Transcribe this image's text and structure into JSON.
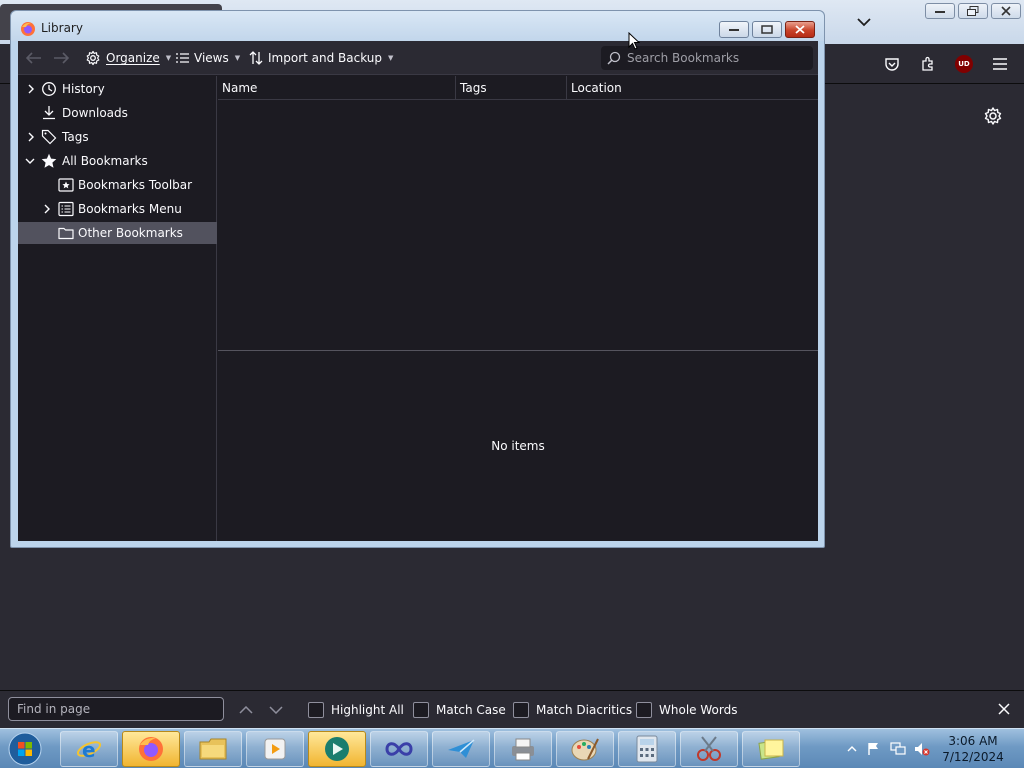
{
  "library": {
    "title": "Library",
    "toolbar": {
      "back": "Back",
      "forward": "Forward",
      "organize": "Organize",
      "views": "Views",
      "import_backup": "Import and Backup"
    },
    "search": {
      "placeholder": "Search Bookmarks",
      "value": ""
    },
    "tree": [
      {
        "label": "History",
        "expanded": false,
        "selected": false
      },
      {
        "label": "Downloads",
        "expanded": null,
        "selected": false
      },
      {
        "label": "Tags",
        "expanded": false,
        "selected": false
      },
      {
        "label": "All Bookmarks",
        "expanded": true,
        "selected": false
      },
      {
        "label": "Bookmarks Toolbar",
        "expanded": null,
        "selected": false
      },
      {
        "label": "Bookmarks Menu",
        "expanded": false,
        "selected": false
      },
      {
        "label": "Other Bookmarks",
        "expanded": null,
        "selected": true
      }
    ],
    "columns": [
      "Name",
      "Tags",
      "Location"
    ],
    "details": {
      "empty_text": "No items"
    }
  },
  "findbar": {
    "placeholder": "Find in page",
    "value": "",
    "options": [
      {
        "label": "Highlight All",
        "checked": false
      },
      {
        "label": "Match Case",
        "checked": false
      },
      {
        "label": "Match Diacritics",
        "checked": false
      },
      {
        "label": "Whole Words",
        "checked": false
      }
    ]
  },
  "browser": {
    "extension_badge": "UD"
  },
  "taskbar": {
    "time": "3:06 AM",
    "date": "7/12/2024",
    "apps": [
      "internet-explorer",
      "firefox",
      "file-explorer",
      "media-player",
      "app-viewer",
      "infinity-app",
      "mail-app",
      "printer-app",
      "paint",
      "calculator",
      "snipping-tool",
      "sticky-notes"
    ]
  },
  "colors": {
    "surface": "#2b2a33",
    "content": "#1c1b22",
    "selected_row": "#52525e",
    "text": "#fbfbfe",
    "aero_glass": "#bcd4ec"
  }
}
